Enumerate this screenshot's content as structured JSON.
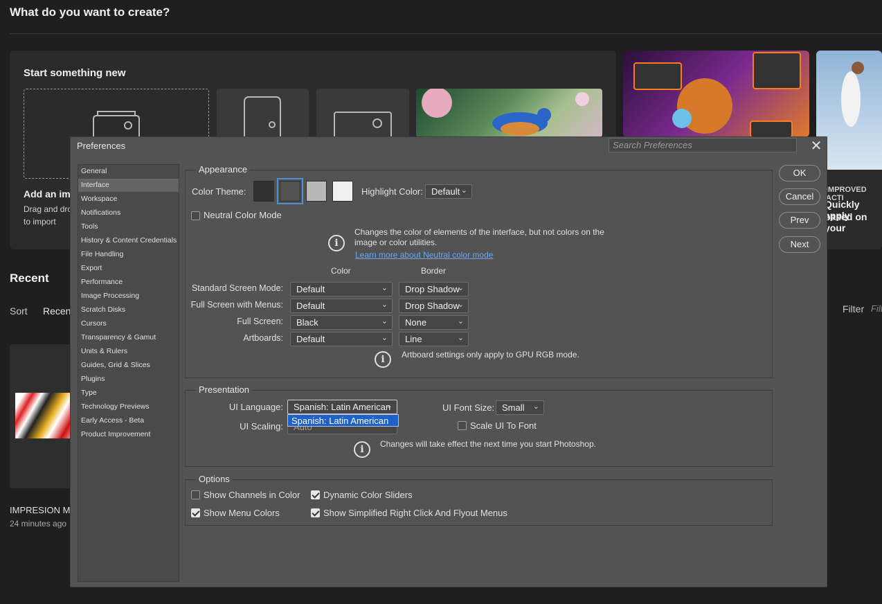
{
  "home": {
    "title": "What do you want to create?",
    "start_title": "Start something new",
    "add_image_title": "Add an imag",
    "add_image_desc1": "Drag and drop",
    "add_image_desc2": "to import",
    "promo_kicker": "IMPROVED ACTI",
    "promo_line1": "Quickly apply",
    "promo_line2": "based on your",
    "recent_title": "Recent",
    "sort_label": "Sort",
    "sort_value": "Recent",
    "filter_label": "Filter",
    "filter_placeholder": "Filt",
    "recent_file_name": "IMPRESION MC",
    "recent_file_time": "24 minutes ago"
  },
  "dialog": {
    "title": "Preferences",
    "search_placeholder": "Search Preferences",
    "close_glyph": "✕",
    "nav": [
      "General",
      "Interface",
      "Workspace",
      "Notifications",
      "Tools",
      "History & Content Credentials",
      "File Handling",
      "Export",
      "Performance",
      "Image Processing",
      "Scratch Disks",
      "Cursors",
      "Transparency & Gamut",
      "Units & Rulers",
      "Guides, Grid & Slices",
      "Plugins",
      "Type",
      "Technology Previews",
      "Early Access - Beta",
      "Product Improvement"
    ],
    "nav_selected": "Interface",
    "buttons": {
      "ok": "OK",
      "cancel": "Cancel",
      "prev": "Prev",
      "next": "Next"
    },
    "appearance": {
      "title": "Appearance",
      "color_theme_label": "Color Theme:",
      "theme_colors": [
        "#323232",
        "#535353",
        "#b8b8b8",
        "#f0f0f0"
      ],
      "highlight_label": "Highlight Color:",
      "highlight_value": "Default",
      "neutral_label": "Neutral Color Mode",
      "neutral_checked": false,
      "info1_line1": "Changes the color of elements of the interface, but not colors on the",
      "info1_line2": "image or color utilities.",
      "info1_link": "Learn more about Neutral color mode",
      "col_color": "Color",
      "col_border": "Border",
      "rows": [
        {
          "label": "Standard Screen Mode:",
          "color": "Default",
          "border": "Drop Shadow"
        },
        {
          "label": "Full Screen with Menus:",
          "color": "Default",
          "border": "Drop Shadow"
        },
        {
          "label": "Full Screen:",
          "color": "Black",
          "border": "None"
        },
        {
          "label": "Artboards:",
          "color": "Default",
          "border": "Line"
        }
      ],
      "artboard_note": "Artboard settings only apply to GPU RGB mode."
    },
    "presentation": {
      "title": "Presentation",
      "ui_language_label": "UI Language:",
      "ui_language_value": "Spanish: Latin American",
      "ui_language_option": "Spanish: Latin American",
      "ui_font_size_label": "UI Font Size:",
      "ui_font_size_value": "Small",
      "ui_scaling_label": "UI Scaling:",
      "ui_scaling_value": "Auto",
      "scale_to_font_label": "Scale UI To Font",
      "scale_to_font_checked": false,
      "note": "Changes will take effect the next time you start Photoshop."
    },
    "options": {
      "title": "Options",
      "show_channels": "Show Channels in Color",
      "show_channels_checked": false,
      "dynamic_sliders": "Dynamic Color Sliders",
      "dynamic_sliders_checked": true,
      "show_menu_colors": "Show Menu Colors",
      "show_menu_colors_checked": true,
      "simplified_menus": "Show Simplified Right Click And Flyout Menus",
      "simplified_menus_checked": true
    },
    "chevron": "⌄",
    "info_glyph": "i"
  }
}
